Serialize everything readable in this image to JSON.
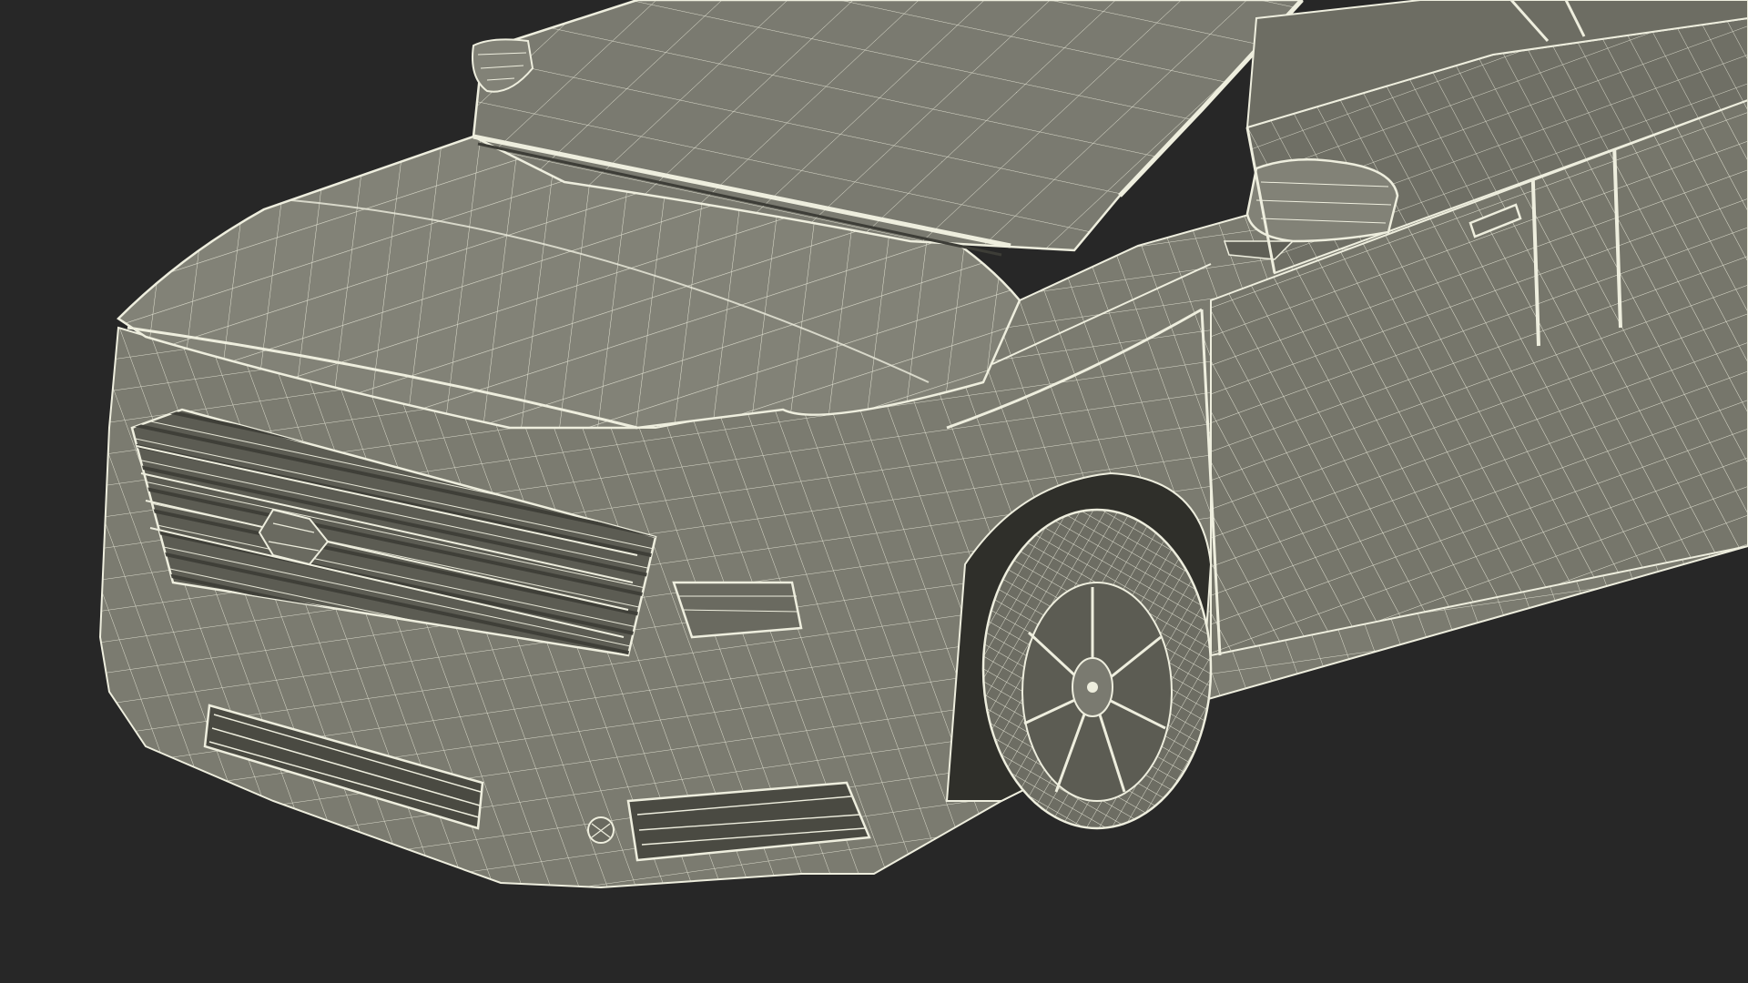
{
  "scene": {
    "subject": "car-wireframe-render",
    "colors": {
      "background": "#272727",
      "body_fill": "#7d7d72",
      "body_shadow": "#5f5f56",
      "body_highlight": "#8f8f84",
      "wire": "#eeeede",
      "dark_detail": "#3d3d37"
    }
  }
}
